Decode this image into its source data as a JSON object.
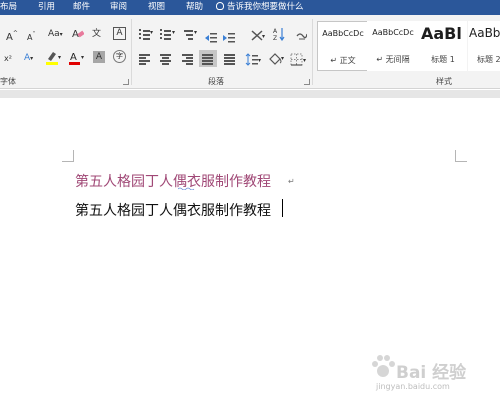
{
  "tabs": [
    {
      "label": "布局"
    },
    {
      "label": "引用"
    },
    {
      "label": "邮件"
    },
    {
      "label": "审阅"
    },
    {
      "label": "视图"
    },
    {
      "label": "帮助"
    }
  ],
  "tell_me": "告诉我你想要做什么",
  "groups": {
    "font": "字体",
    "paragraph": "段落",
    "styles": "样式"
  },
  "font_buttons": {
    "grow": "A",
    "grow_sup": "^",
    "shrink": "A",
    "shrink_sup": "˅",
    "case": "Aa",
    "pinyin": "文",
    "border_char": "A",
    "superscript": "x²",
    "effects": "A",
    "font_color": "A",
    "char_shading": "A",
    "enclose": "字"
  },
  "styles": [
    {
      "preview": "AaBbCcDc",
      "name": "↵ 正文",
      "selected": true
    },
    {
      "preview": "AaBbCcDc",
      "name": "↵ 无间隔",
      "selected": false
    },
    {
      "preview": "AaBl",
      "name": "标题 1",
      "selected": false
    },
    {
      "preview": "AaBb",
      "name": "标题 2",
      "selected": false
    }
  ],
  "document": {
    "line1": "第五人格园丁人偶衣服制作教程",
    "line2": "第五人格园丁人偶衣服制作教程"
  },
  "watermark": {
    "brand": "Bai 经验",
    "url": "jingyan.baidu.com"
  },
  "colors": {
    "tab_bar": "#2b579a",
    "ribbon": "#f3f3f3",
    "heading_text": "#a04876",
    "font_color_bar": "#e00000",
    "highlight_bar": "#ffff00"
  }
}
